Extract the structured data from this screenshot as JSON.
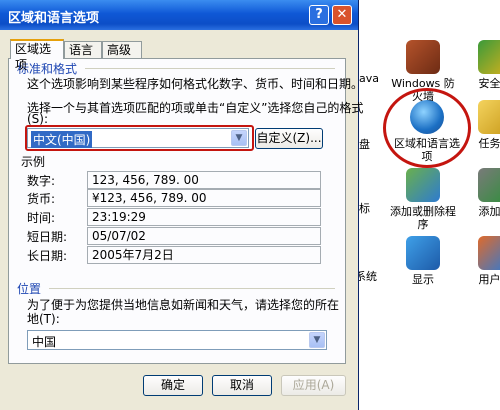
{
  "dialog": {
    "title": "区域和语言选项",
    "help_glyph": "?",
    "close_glyph": "✕",
    "tabs": [
      {
        "label": "区域选项",
        "active": true
      },
      {
        "label": "语言",
        "active": false
      },
      {
        "label": "高级",
        "active": false
      }
    ],
    "standards": {
      "group_label": "标准和格式",
      "description": "这个选项影响到某些程序如何格式化数字、货币、时间和日期。",
      "instruction_line1": "选择一个与其首选项匹配的项或单击“自定义”选择您自己的格式",
      "instruction_line2": "(S):",
      "selected_locale": "中文(中国)",
      "customize_label": "自定义(Z)..."
    },
    "samples": {
      "heading": "示例",
      "rows": [
        {
          "label": "数字:",
          "value": "123, 456, 789. 00"
        },
        {
          "label": "货币:",
          "value": "¥123, 456, 789. 00"
        },
        {
          "label": "时间:",
          "value": "23:19:29"
        },
        {
          "label": "短日期:",
          "value": "05/07/02"
        },
        {
          "label": "长日期:",
          "value": "2005年7月2日"
        }
      ]
    },
    "location": {
      "group_label": "位置",
      "description_line1": "为了便于为您提供当地信息如新闻和天气，请选择您的所在",
      "description_line2": "地(T):",
      "selected": "中国"
    },
    "buttons": {
      "ok": "确定",
      "cancel": "取消",
      "apply": "应用(A)"
    }
  },
  "control_panel": {
    "items": [
      {
        "label": "Windows 防火墙",
        "icon": "firewall-icon"
      },
      {
        "label": "安全中",
        "icon": "security-center-icon"
      },
      {
        "label": "区域和语言选项",
        "icon": "globe-icon"
      },
      {
        "label": "任务计",
        "icon": "scheduled-tasks-icon"
      },
      {
        "label": "添加或删除程序",
        "icon": "add-remove-programs-icon"
      },
      {
        "label": "添加硬",
        "icon": "add-hardware-icon"
      },
      {
        "label": "显示",
        "icon": "display-icon"
      },
      {
        "label": "用户帐",
        "icon": "user-accounts-icon"
      }
    ],
    "partial_labels": [
      "ava",
      "盘",
      "标",
      "系统"
    ]
  },
  "colors": {
    "highlight_red": "#c4150f",
    "titlebar_blue": "#0c4ec7",
    "selection_blue": "#316ac5"
  }
}
